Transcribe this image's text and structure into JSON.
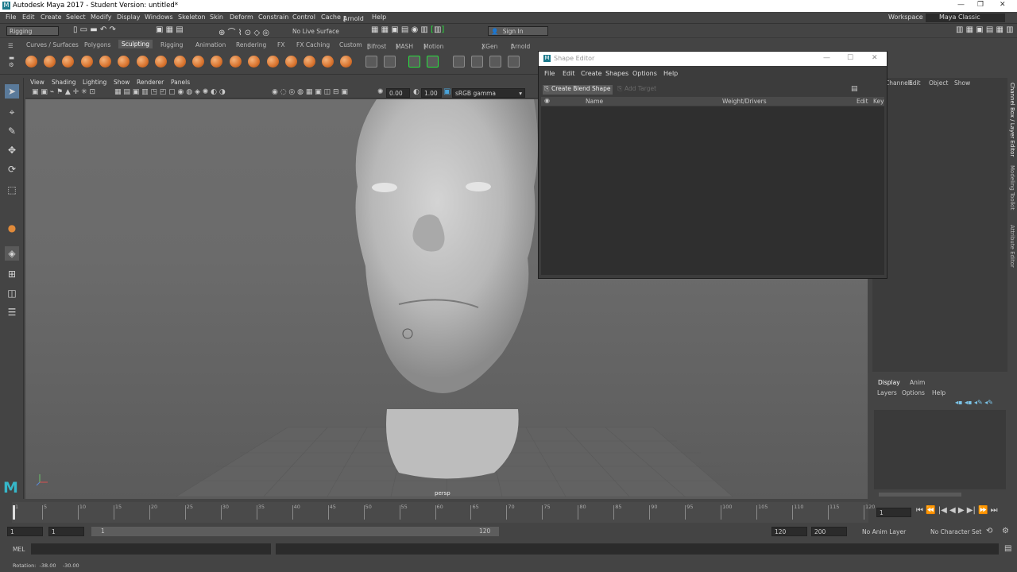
{
  "window": {
    "title": "Autodesk Maya 2017 - Student Version: untitled*"
  },
  "menubar": {
    "items": [
      "File",
      "Edit",
      "Create",
      "Select",
      "Modify",
      "Display",
      "Windows",
      "Skeleton",
      "Skin",
      "Deform",
      "Constrain",
      "Control",
      "Cache",
      "Arnold",
      "Help"
    ],
    "workspace_label": "Workspace :",
    "workspace_value": "Maya Classic"
  },
  "statusline": {
    "menu_set": "Rigging",
    "live_surface": "No Live Surface",
    "sign_in": "Sign In"
  },
  "shelf": {
    "tabs": [
      "Curves / Surfaces",
      "Polygons",
      "Sculpting",
      "Rigging",
      "Animation",
      "Rendering",
      "FX",
      "FX Caching",
      "Custom",
      "Bifrost",
      "MASH",
      "Motion Graphics",
      "XGen",
      "Arnold"
    ],
    "active_tab": "Sculpting"
  },
  "panel": {
    "menus": [
      "View",
      "Shading",
      "Lighting",
      "Show",
      "Renderer",
      "Panels"
    ],
    "exposure": "0.00",
    "gamma": "1.00",
    "color_space": "sRGB gamma",
    "camera_label": "persp"
  },
  "shape_editor": {
    "title": "Shape Editor",
    "menus": [
      "File",
      "Edit",
      "Create",
      "Shapes",
      "Options",
      "Help"
    ],
    "create_blend_shape": "Create Blend Shape",
    "add_target": "Add Target",
    "columns": {
      "name": "Name",
      "weight": "Weight/Drivers",
      "edit": "Edit",
      "key": "Key"
    }
  },
  "channel_box": {
    "menus": [
      "Channels",
      "Edit",
      "Object",
      "Show"
    ]
  },
  "side_tabs": [
    "Channel Box / Layer Editor",
    "Modeling Toolkit",
    "Attribute Editor"
  ],
  "layer_editor": {
    "tabs": [
      "Display",
      "Anim"
    ],
    "menus": [
      "Layers",
      "Options",
      "Help"
    ]
  },
  "timeline": {
    "ticks": [
      "1",
      "5",
      "10",
      "15",
      "20",
      "25",
      "30",
      "35",
      "40",
      "45",
      "50",
      "55",
      "60",
      "65",
      "70",
      "75",
      "80",
      "85",
      "90",
      "95",
      "100",
      "105",
      "110",
      "115",
      "120"
    ],
    "current_frame": "1"
  },
  "range": {
    "start": "1",
    "inner_start": "1",
    "slider_start": "1",
    "slider_end": "120",
    "inner_end": "120",
    "end": "200",
    "anim_layer": "No Anim Layer",
    "char_set": "No Character Set"
  },
  "command_line": {
    "mode": "MEL"
  },
  "help_line": {
    "text": "Rotation:  -38.00    -30.00"
  },
  "colors": {
    "accent_green": "#27e23e",
    "bg": "#444444",
    "viewport": "#6b6b6b",
    "sculpt_orange": "#d9742f"
  }
}
